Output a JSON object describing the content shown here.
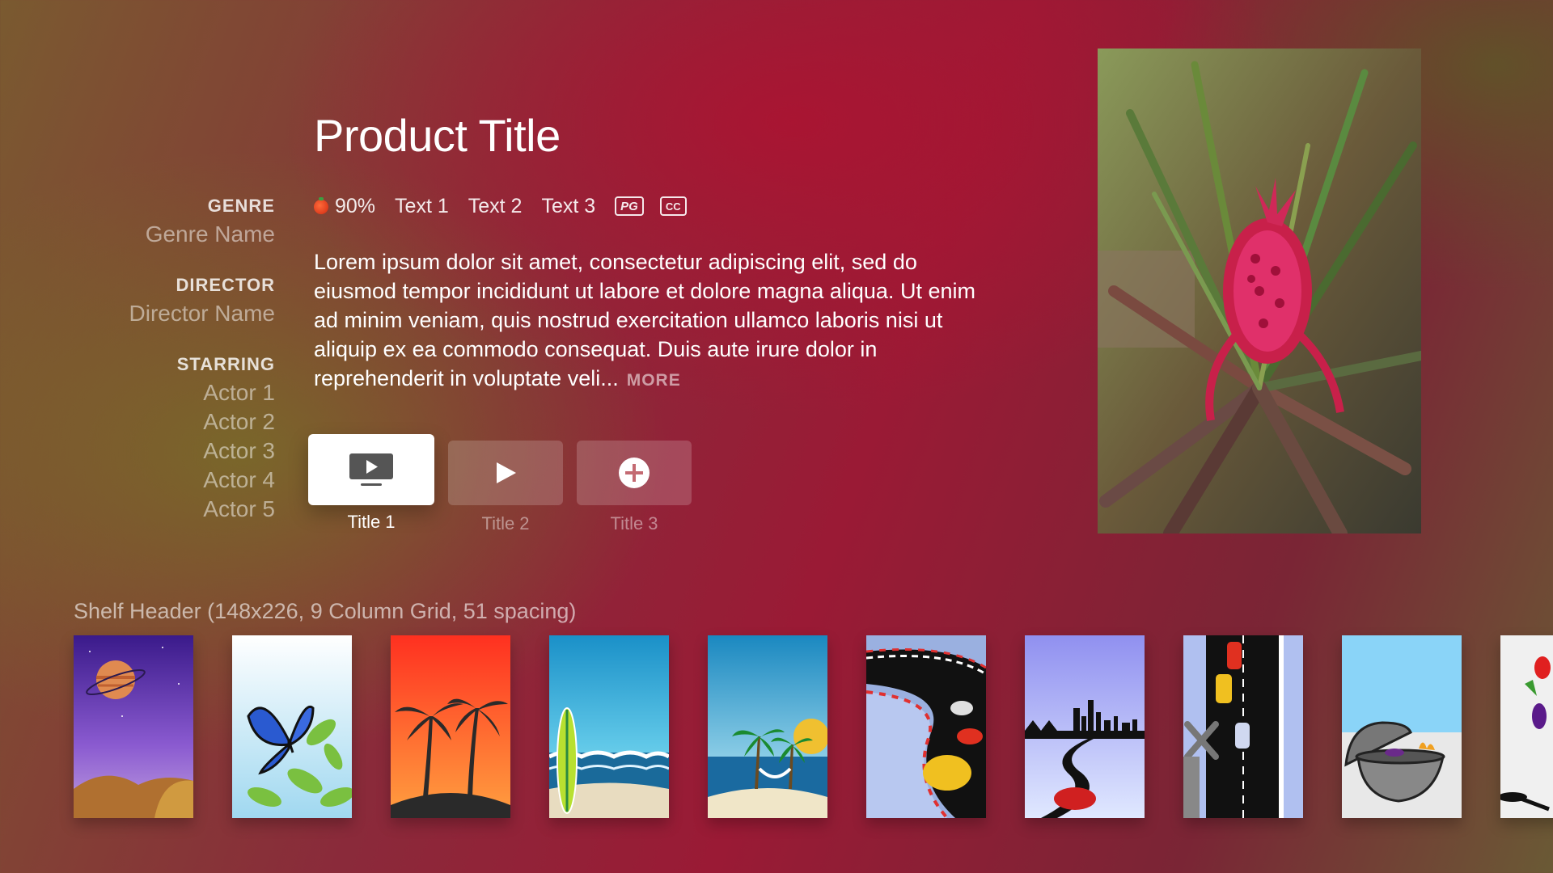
{
  "product": {
    "title": "Product Title",
    "rating": "90%",
    "rating_icon": "tomato-icon",
    "text1": "Text 1",
    "text2": "Text 2",
    "text3": "Text 3",
    "badge_rating": "PG",
    "badge_cc": "CC",
    "description": "Lorem ipsum dolor sit amet, consectetur adipiscing elit, sed do eiusmod tempor incididunt ut labore et dolore magna aliqua. Ut enim ad minim veniam, quis nostrud exercitation ullamco laboris nisi ut aliquip ex ea commodo consequat. Duis aute irure dolor in reprehenderit in voluptate veli...",
    "more_label": "MORE"
  },
  "meta": {
    "genre_heading": "GENRE",
    "genre_value": "Genre Name",
    "director_heading": "DIRECTOR",
    "director_value": "Director Name",
    "starring_heading": "STARRING",
    "actors": [
      "Actor 1",
      "Actor 2",
      "Actor 3",
      "Actor 4",
      "Actor 5"
    ]
  },
  "actions": [
    {
      "label": "Title 1",
      "icon": "tv-play-icon",
      "focused": true
    },
    {
      "label": "Title 2",
      "icon": "play-icon",
      "focused": false
    },
    {
      "label": "Title 3",
      "icon": "add-circle-icon",
      "focused": false
    }
  ],
  "shelf": {
    "header": "Shelf Header (148x226, 9 Column Grid, 51 spacing)",
    "items": [
      {
        "name": "planet-poster"
      },
      {
        "name": "butterfly-poster"
      },
      {
        "name": "palm-sunset-poster"
      },
      {
        "name": "surfboard-beach-poster"
      },
      {
        "name": "hammock-island-poster"
      },
      {
        "name": "race-track-poster"
      },
      {
        "name": "city-road-poster"
      },
      {
        "name": "highway-cars-poster"
      },
      {
        "name": "grill-poster"
      },
      {
        "name": "vegetables-poster"
      }
    ]
  },
  "colors": {
    "focused_button": "#ffffff",
    "unfocused_button": "rgba(255,255,255,0.18)"
  }
}
